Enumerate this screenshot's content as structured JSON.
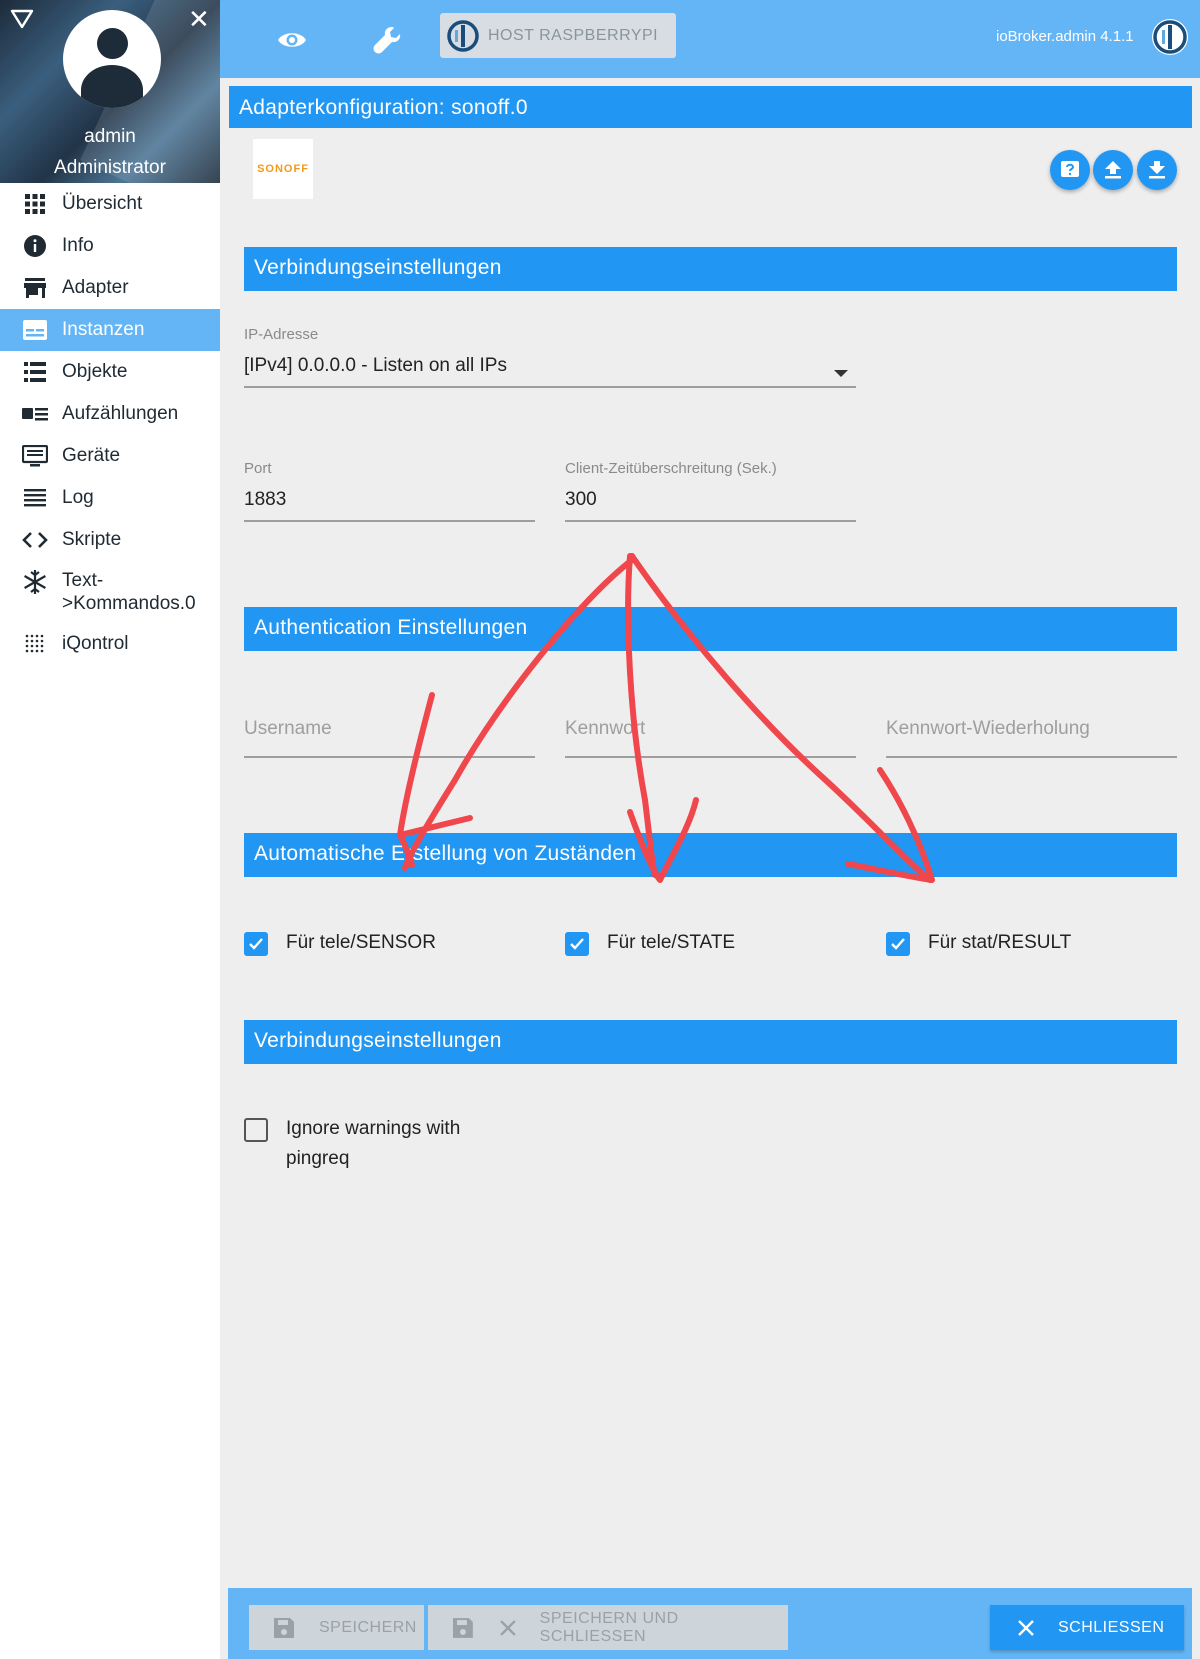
{
  "sidebar": {
    "user_name": "admin",
    "user_role": "Administrator",
    "items": [
      {
        "label": "Übersicht",
        "icon": "grid-icon"
      },
      {
        "label": "Info",
        "icon": "info-icon"
      },
      {
        "label": "Adapter",
        "icon": "store-icon"
      },
      {
        "label": "Instanzen",
        "icon": "instances-icon",
        "active": true
      },
      {
        "label": "Objekte",
        "icon": "list-icon"
      },
      {
        "label": "Aufzählungen",
        "icon": "enum-icon"
      },
      {
        "label": "Geräte",
        "icon": "devices-icon"
      },
      {
        "label": "Log",
        "icon": "log-icon"
      },
      {
        "label": "Skripte",
        "icon": "code-icon"
      },
      {
        "label": "Text->Kommandos.0",
        "label_line1": "Text-",
        "label_line2": ">Kommandos.0",
        "icon": "snowflake-icon"
      },
      {
        "label": "iQontrol",
        "icon": "dots-grid-icon"
      }
    ]
  },
  "topbar": {
    "host_label": "HOST RASPBERRYPI",
    "version": "ioBroker.admin 4.1.1"
  },
  "main": {
    "title": "Adapterkonfiguration: sonoff.0",
    "logo_text": "SONOFF",
    "sections": {
      "connection": "Verbindungseinstellungen",
      "auth": "Authentication Einstellungen",
      "auto": "Automatische Erstellung von Zuständen",
      "connection2": "Verbindungseinstellungen"
    },
    "fields": {
      "ip_label": "IP-Adresse",
      "ip_value": "[IPv4] 0.0.0.0 - Listen on all IPs",
      "port_label": "Port",
      "port_value": "1883",
      "timeout_label": "Client-Zeitüberschreitung (Sek.)",
      "timeout_value": "300",
      "username_placeholder": "Username",
      "password_placeholder": "Kennwort",
      "password_repeat_placeholder": "Kennwort-Wiederholung"
    },
    "checkboxes": {
      "tele_sensor": {
        "label": "Für tele/SENSOR",
        "checked": true
      },
      "tele_state": {
        "label": "Für tele/STATE",
        "checked": true
      },
      "stat_result": {
        "label": "Für stat/RESULT",
        "checked": true
      },
      "ignore_pingreq": {
        "label_line1": "Ignore warnings with",
        "label_line2": "pingreq",
        "checked": false
      }
    }
  },
  "bottombar": {
    "save_label": "SPEICHERN",
    "save_close_label": "SPEICHERN UND SCHLIESSEN",
    "close_label": "SCHLIESSEN"
  },
  "colors": {
    "accent": "#2196f3",
    "bar": "#64b5f6",
    "annotation": "#f0474c"
  }
}
